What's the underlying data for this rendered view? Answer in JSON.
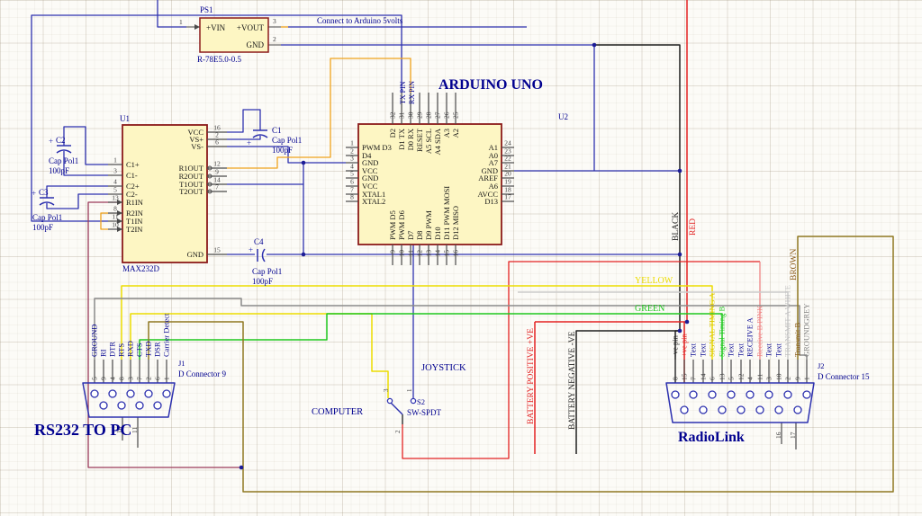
{
  "colors": {
    "blue": "#2d31af",
    "navy": "#00008f",
    "orange": "#efa31d",
    "yellow": "#ecdc00",
    "green": "#1ec71e",
    "grey": "#8a8a8a",
    "white_wire": "#cccccc",
    "brown": "#8f7820",
    "maroon": "#9a3a5a",
    "red": "#e32222",
    "salmon": "#ee8585",
    "black": "#1f1f1f",
    "dot": "#1c1c96",
    "body_fill": "#fdf6c3",
    "body_stroke": "#8b1a1a",
    "pin": "#4a4a4a",
    "num": "#3f3f3f",
    "text": "#141414",
    "label_grey": "#808080",
    "label_brown": "#8a5a18",
    "label_green": "#1ec71e",
    "label_yellow": "#d8c400",
    "label_pink": "#ee8888",
    "label_red": "#e32222",
    "label_white": "#c0c0c0",
    "label_black": "#222222"
  },
  "titles": {
    "arduino": "ARDUINO UNO",
    "rs232": "RS232 TO PC",
    "radiolink": "RadioLink",
    "joystick": "JOYSTICK",
    "computer": "COMPUTER",
    "note5v": "Connect to Arduino 5volts"
  },
  "wire_labels": {
    "yellow": "YELLOW",
    "green": "GREEN",
    "black": "BLACK",
    "red": "RED",
    "brown": "BROWN",
    "batt_pos": "BATTERY POSITIVE +VE",
    "batt_neg": "BATTERY NEGATIVE -VE",
    "tx": "TX PIN",
    "rx": "RX PIN"
  },
  "ps1": {
    "ref": "PS1",
    "part": "R-78E5.0-0.5",
    "pin_vin": "+VIN",
    "pin_vout": "+VOUT",
    "pin_gnd": "GND",
    "n1": "1",
    "n2": "2",
    "n3": "3"
  },
  "u1": {
    "ref": "U1",
    "part": "MAX232D",
    "left": [
      {
        "n": "1",
        "t": "C1+"
      },
      {
        "n": "3",
        "t": "C1-"
      },
      {
        "n": "4",
        "t": "C2+"
      },
      {
        "n": "5",
        "t": "C2-"
      },
      {
        "n": "13",
        "t": "R1IN"
      },
      {
        "n": "8",
        "t": "R2IN"
      },
      {
        "n": "11",
        "t": "T1IN"
      },
      {
        "n": "10",
        "t": "T2IN"
      }
    ],
    "right": [
      {
        "n": "16",
        "t": "VCC"
      },
      {
        "n": "2",
        "t": "VS+"
      },
      {
        "n": "6",
        "t": "VS-"
      },
      {
        "n": "12",
        "t": "R1OUT"
      },
      {
        "n": "9",
        "t": "R2OUT"
      },
      {
        "n": "14",
        "t": "T1OUT"
      },
      {
        "n": "7",
        "t": "T2OUT"
      },
      {
        "n": "15",
        "t": "GND"
      }
    ]
  },
  "u2": {
    "ref": "U2",
    "left": [
      {
        "n": "1",
        "t": "PWM D3"
      },
      {
        "n": "2",
        "t": "D4"
      },
      {
        "n": "3",
        "t": "GND"
      },
      {
        "n": "4",
        "t": "VCC"
      },
      {
        "n": "5",
        "t": "GND"
      },
      {
        "n": "6",
        "t": "VCC"
      },
      {
        "n": "7",
        "t": "XTAL1"
      },
      {
        "n": "8",
        "t": "XTAL2"
      }
    ],
    "right": [
      {
        "n": "24",
        "t": "A1"
      },
      {
        "n": "23",
        "t": "A0"
      },
      {
        "n": "22",
        "t": "A7"
      },
      {
        "n": "21",
        "t": "GND"
      },
      {
        "n": "20",
        "t": "AREF"
      },
      {
        "n": "19",
        "t": "A6"
      },
      {
        "n": "18",
        "t": "AVCC"
      },
      {
        "n": "17",
        "t": "D13"
      }
    ],
    "top": [
      {
        "n": "32",
        "t": "D2"
      },
      {
        "n": "31",
        "t": "D1 TX"
      },
      {
        "n": "30",
        "t": "D0 RX"
      },
      {
        "n": "29",
        "t": "RESET"
      },
      {
        "n": "28",
        "t": "A5 SCL"
      },
      {
        "n": "27",
        "t": "A4 SDA"
      },
      {
        "n": "26",
        "t": "A3"
      },
      {
        "n": "25",
        "t": "A2"
      }
    ],
    "bottom": [
      {
        "n": "9",
        "t": "PWM D5"
      },
      {
        "n": "10",
        "t": "PWM D6"
      },
      {
        "n": "11",
        "t": "D7"
      },
      {
        "n": "12",
        "t": "D8"
      },
      {
        "n": "13",
        "t": "D9 PWM"
      },
      {
        "n": "14",
        "t": "D10"
      },
      {
        "n": "15",
        "t": "D11 PWM MOSI"
      },
      {
        "n": "16",
        "t": "D12 MISO"
      }
    ]
  },
  "caps": {
    "plus": "+",
    "c1": {
      "ref": "C1",
      "part": "Cap Pol1",
      "value": "100pF"
    },
    "c2": {
      "ref": "C2",
      "part": "Cap Pol1",
      "value": "100pF"
    },
    "c3": {
      "ref": "C3",
      "part": "Cap Pol1",
      "value": "100pF"
    },
    "c4": {
      "ref": "C4",
      "part": "Cap Pol1",
      "value": "100pF"
    }
  },
  "j1": {
    "ref": "J1",
    "part": "D Connector 9",
    "pins": [
      {
        "n": "5",
        "t": "GROUND"
      },
      {
        "n": "9",
        "t": "RI"
      },
      {
        "n": "4",
        "t": "DTR"
      },
      {
        "n": "8",
        "t": "RTS"
      },
      {
        "n": "3",
        "t": "RXD"
      },
      {
        "n": "7",
        "t": "CTS"
      },
      {
        "n": "2",
        "t": "TXD"
      },
      {
        "n": "6",
        "t": "DSR"
      },
      {
        "n": "1",
        "t": "Carrier Detect"
      }
    ],
    "bottom": [
      {
        "n": "10",
        "t": ""
      },
      {
        "n": "11",
        "t": ""
      }
    ]
  },
  "j2": {
    "ref": "J2",
    "part": "D Connector 15",
    "pins": [
      {
        "n": "8",
        "t": "-ve pin",
        "c": "label_black"
      },
      {
        "n": "15",
        "t": "+ve pin",
        "c": "label_red"
      },
      {
        "n": "7",
        "t": "Text"
      },
      {
        "n": "14",
        "t": "Text"
      },
      {
        "n": "6",
        "t": "SIGNAL TIMING A",
        "c": "label_yellow"
      },
      {
        "n": "13",
        "t": "Signal Timing B",
        "c": "label_green"
      },
      {
        "n": "5",
        "t": "Text"
      },
      {
        "n": "12",
        "t": "Text"
      },
      {
        "n": "4",
        "t": "RECEIVE A",
        "c": "navy"
      },
      {
        "n": "11",
        "t": "Receive B PINK",
        "c": "label_pink"
      },
      {
        "n": "3",
        "t": "Text"
      },
      {
        "n": "10",
        "t": "Text"
      },
      {
        "n": "2",
        "t": "TRANSMIT A WHITE",
        "c": "label_white"
      },
      {
        "n": "9",
        "t": "Transmit B",
        "c": "label_brown"
      },
      {
        "n": "1",
        "t": "GROUNDGREY",
        "c": "label_grey"
      }
    ],
    "bottom": [
      {
        "n": "16",
        "t": ""
      },
      {
        "n": "17",
        "t": ""
      }
    ]
  },
  "s2": {
    "ref": "S2",
    "part": "SW-SPDT",
    "n1": "1",
    "n2": "2",
    "n3": "3"
  }
}
